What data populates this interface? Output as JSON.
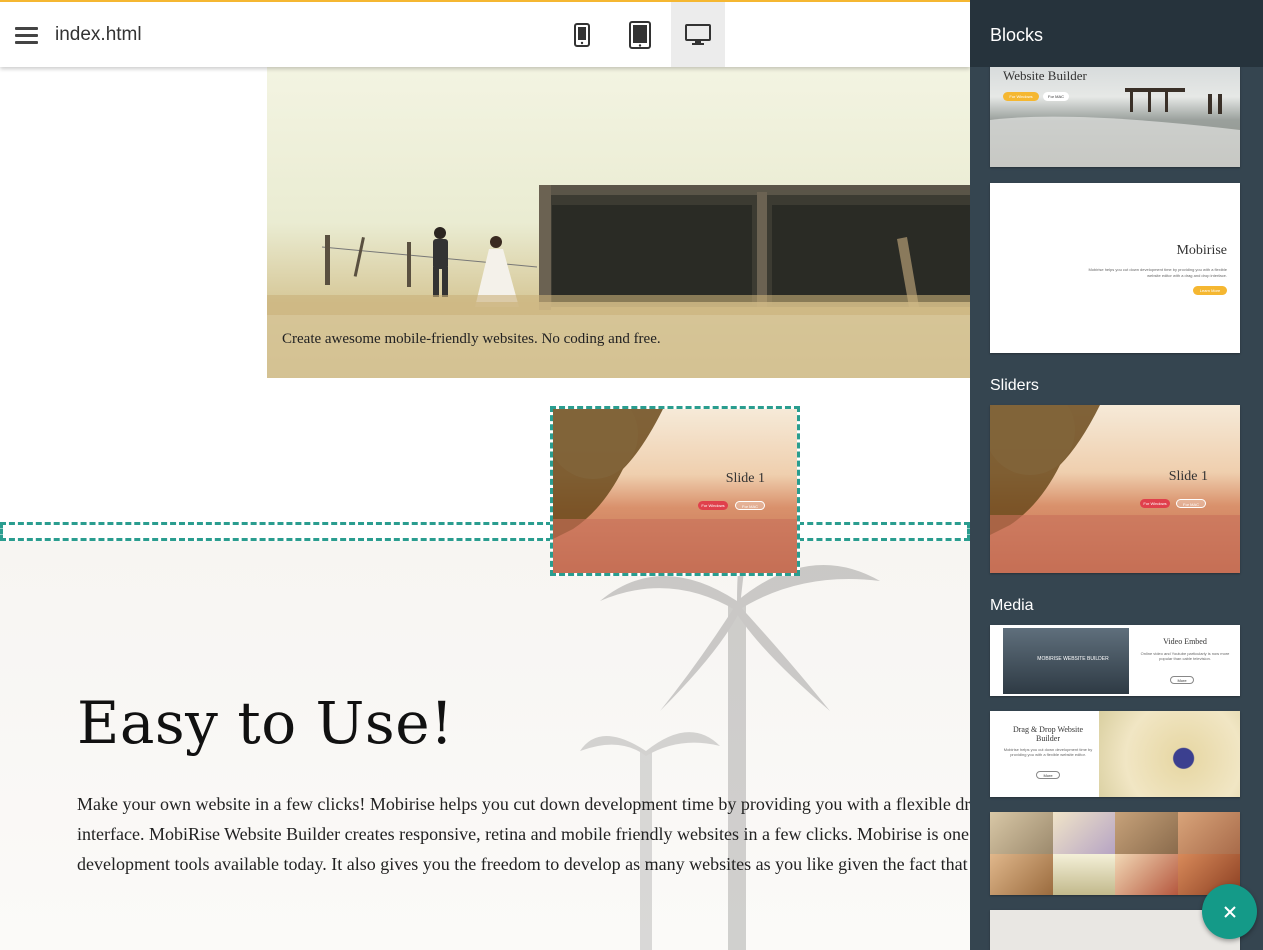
{
  "topbar": {
    "filename": "index.html"
  },
  "hero": {
    "caption": "Create awesome mobile-friendly websites. No coding and free."
  },
  "drag_preview": {
    "slide_title": "Slide 1",
    "btn1": "For Windows",
    "btn2": "For MAC"
  },
  "content": {
    "heading": "Easy to Use!",
    "paragraph": "Make your own website in a few clicks! Mobirise helps you cut down development time by providing you with a flexible drag and drop interface. MobiRise Website Builder creates responsive, retina and mobile friendly websites in a few clicks. Mobirise is one of the easiest website development tools available today. It also gives you the freedom to develop as many websites as you like given the fact that it is a desktop app."
  },
  "panel": {
    "title": "Blocks",
    "headers_block1": {
      "title": "Website Builder",
      "btn1": "For Windows",
      "btn2": "For MAC"
    },
    "headers_block2": {
      "title": "Mobirise",
      "text": "Mobirise helps you cut down development time by providing you with a flexible website editor with a drag and drop interface.",
      "btn": "Learn More"
    },
    "sliders_label": "Sliders",
    "slider_block": {
      "title": "Slide 1",
      "btn1": "For Windows",
      "btn2": "For MAC"
    },
    "media_label": "Media",
    "media_block1": {
      "title": "Video Embed",
      "text": "Online video and Youtube particularly is now more popular than cable television.",
      "btn": "More",
      "video_title": "MOBIRISE WEBSITE BUILDER"
    },
    "media_block2": {
      "title": "Drag & Drop Website Builder",
      "text": "Mobirise helps you cut down development time by providing you with a flexible website editor.",
      "btn": "More"
    }
  },
  "colors": {
    "accent": "#2a9d8f",
    "fab": "#149a88",
    "panel_bg": "#354550",
    "panel_header": "#26333c",
    "topbar_border": "#f5b731",
    "button_red": "#e0404c",
    "button_yellow": "#f5b731"
  },
  "icons": [
    "menu-icon",
    "phone-icon",
    "tablet-icon",
    "desktop-icon",
    "close-icon"
  ]
}
